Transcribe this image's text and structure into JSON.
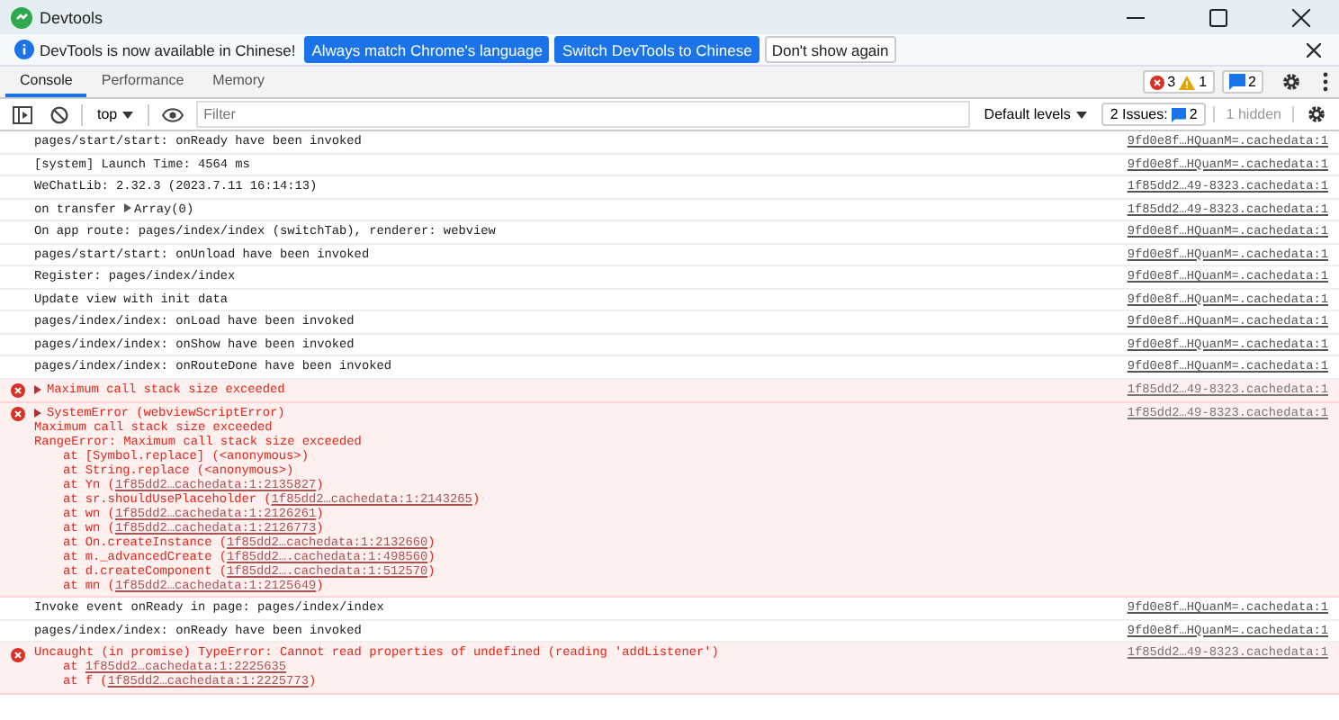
{
  "window": {
    "title": "Devtools"
  },
  "infobar": {
    "message": "DevTools is now available in Chinese!",
    "buttons": [
      {
        "label": "Always match Chrome's language",
        "kind": "primary"
      },
      {
        "label": "Switch DevTools to Chinese",
        "kind": "primary"
      },
      {
        "label": "Don't show again",
        "kind": "plain"
      }
    ]
  },
  "tabs": [
    {
      "label": "Console",
      "selected": true
    },
    {
      "label": "Performance",
      "selected": false
    },
    {
      "label": "Memory",
      "selected": false
    }
  ],
  "counters": {
    "errors": "3",
    "warnings": "1",
    "issues": "2"
  },
  "toolbar": {
    "context": "top",
    "filter_placeholder": "Filter",
    "levels": "Default levels",
    "issues_label": "2 Issues:",
    "issues_count": "2",
    "hidden": "1 hidden"
  },
  "messages": [
    {
      "kind": "log",
      "text": "pages/start/start: onReady have been invoked",
      "source": "9fd0e8f…HQuanM=.cachedata:1"
    },
    {
      "kind": "log",
      "text": "[system] Launch Time: 4564 ms",
      "source": "9fd0e8f…HQuanM=.cachedata:1"
    },
    {
      "kind": "log",
      "text": "WeChatLib: 2.32.3 (2023.7.11 16:14:13)",
      "source": "1f85dd2…49-8323.cachedata:1"
    },
    {
      "kind": "log",
      "text": "on transfer",
      "object": "Array(0)",
      "source": "1f85dd2…49-8323.cachedata:1"
    },
    {
      "kind": "log",
      "text": "On app route: pages/index/index (switchTab), renderer: webview",
      "source": "9fd0e8f…HQuanM=.cachedata:1"
    },
    {
      "kind": "log",
      "text": "pages/start/start: onUnload have been invoked",
      "source": "9fd0e8f…HQuanM=.cachedata:1"
    },
    {
      "kind": "log",
      "text": "Register: pages/index/index",
      "source": "9fd0e8f…HQuanM=.cachedata:1"
    },
    {
      "kind": "log",
      "text": "Update view with init data",
      "source": "9fd0e8f…HQuanM=.cachedata:1"
    },
    {
      "kind": "log",
      "text": "pages/index/index: onLoad have been invoked",
      "source": "9fd0e8f…HQuanM=.cachedata:1"
    },
    {
      "kind": "log",
      "text": "pages/index/index: onShow have been invoked",
      "source": "9fd0e8f…HQuanM=.cachedata:1"
    },
    {
      "kind": "log",
      "text": "pages/index/index: onRouteDone have been invoked",
      "source": "9fd0e8f…HQuanM=.cachedata:1"
    },
    {
      "kind": "error",
      "expandable": true,
      "text": "Maximum call stack size exceeded",
      "source": "1f85dd2…49-8323.cachedata:1"
    },
    {
      "kind": "error",
      "expandable": true,
      "text": "SystemError (webviewScriptError)",
      "source": "1f85dd2…49-8323.cachedata:1",
      "details": [
        "Maximum call stack size exceeded",
        "RangeError: Maximum call stack size exceeded"
      ],
      "stack": [
        {
          "pre": "at [Symbol.replace] (<anonymous>)"
        },
        {
          "pre": "at String.replace (<anonymous>)"
        },
        {
          "pre": "at Yn (",
          "link": "1f85dd2…cachedata:1:2135827",
          "post": ")"
        },
        {
          "pre": "at sr.shouldUsePlaceholder (",
          "link": "1f85dd2…cachedata:1:2143265",
          "post": ")"
        },
        {
          "pre": "at wn (",
          "link": "1f85dd2…cachedata:1:2126261",
          "post": ")"
        },
        {
          "pre": "at wn (",
          "link": "1f85dd2…cachedata:1:2126773",
          "post": ")"
        },
        {
          "pre": "at On.createInstance (",
          "link": "1f85dd2…cachedata:1:2132660",
          "post": ")"
        },
        {
          "pre": "at m._advancedCreate (",
          "link": "1f85dd2….cachedata:1:498560",
          "post": ")"
        },
        {
          "pre": "at d.createComponent (",
          "link": "1f85dd2….cachedata:1:512570",
          "post": ")"
        },
        {
          "pre": "at mn (",
          "link": "1f85dd2…cachedata:1:2125649",
          "post": ")"
        }
      ]
    },
    {
      "kind": "log",
      "text": "Invoke event onReady in page: pages/index/index",
      "source": "9fd0e8f…HQuanM=.cachedata:1"
    },
    {
      "kind": "log",
      "text": "pages/index/index: onReady have been invoked",
      "source": "9fd0e8f…HQuanM=.cachedata:1"
    },
    {
      "kind": "error",
      "expandable": false,
      "text": "Uncaught (in promise) TypeError: Cannot read properties of undefined (reading 'addListener')",
      "source": "1f85dd2…49-8323.cachedata:1",
      "stack": [
        {
          "pre": "at ",
          "link": "1f85dd2…cachedata:1:2225635"
        },
        {
          "pre": "at f (",
          "link": "1f85dd2…cachedata:1:2225773",
          "post": ")"
        }
      ]
    }
  ]
}
